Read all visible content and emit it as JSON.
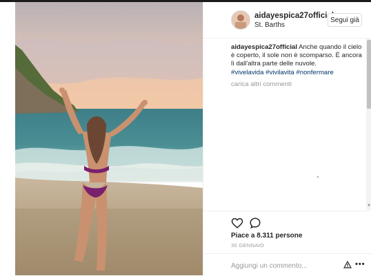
{
  "post": {
    "username": "aidayespica27official",
    "location": "St. Barths",
    "follow_label": "Segui già",
    "caption": {
      "username": "aidayespica27official",
      "text": "Anche quando il cielo è coperto, il sole non è scomparso. È ancora lì dall'altra parte delle nuvole.",
      "hashtags": [
        "#vivelavida",
        "#vivilavita",
        "#nonfermare"
      ]
    },
    "load_more_label": "carica altri commenti",
    "likes_text": "Piace a 8.311 persone",
    "date": "30 GENNAIO",
    "comment_placeholder": "Aggiungi un commento...",
    "more_label": "•••"
  },
  "icons": {
    "like": "heart-icon",
    "comment": "comment-icon",
    "options": "more-options-icon"
  },
  "colors": {
    "hashtag": "#003569",
    "text": "#262626",
    "muted": "#999999",
    "border": "#dbdbdb"
  }
}
